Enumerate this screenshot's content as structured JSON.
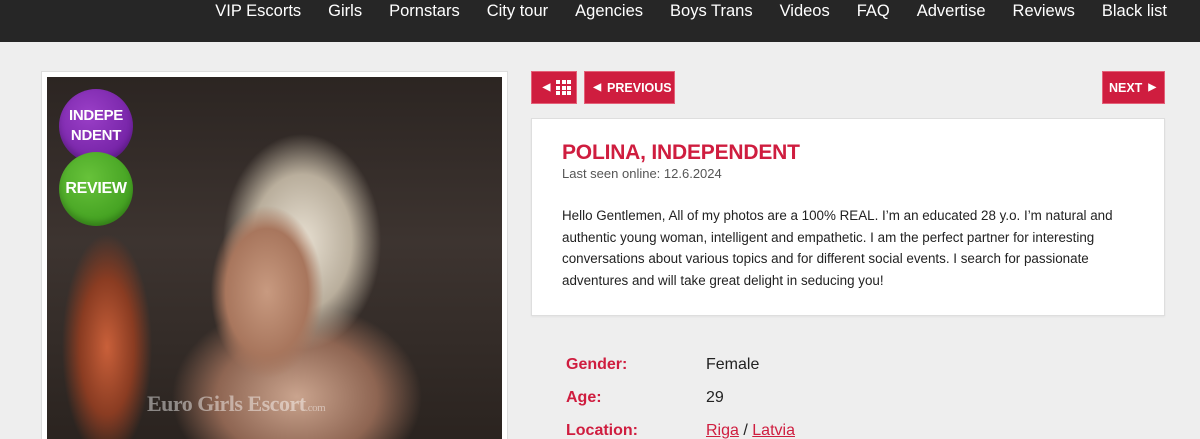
{
  "nav": {
    "items": [
      {
        "label": "VIP Escorts"
      },
      {
        "label": "Girls"
      },
      {
        "label": "Pornstars"
      },
      {
        "label": "City tour"
      },
      {
        "label": "Agencies"
      },
      {
        "label": "Boys Trans"
      },
      {
        "label": "Videos"
      },
      {
        "label": "FAQ"
      },
      {
        "label": "Advertise"
      },
      {
        "label": "Reviews"
      },
      {
        "label": "Black list"
      }
    ]
  },
  "photo": {
    "watermark": "Euro Girls Escort",
    "watermark_suffix": ".com",
    "badges": {
      "independent": "INDEPE NDENT",
      "review": "REVIEW"
    }
  },
  "buttons": {
    "previous": "PREVIOUS",
    "next": "NEXT"
  },
  "profile": {
    "title": "POLINA, INDEPENDENT",
    "last_seen": "Last seen online: 12.6.2024",
    "description": "Hello Gentlemen, All of my photos are a 100% REAL. I’m an educated 28 y.o. I’m natural and authentic young woman, intelligent and empathetic. I am the perfect partner for interesting conversations about various topics and for different social events. I search for passionate adventures and will take great delight in seducing you!"
  },
  "details": {
    "gender_label": "Gender:",
    "gender": "Female",
    "age_label": "Age:",
    "age": "29",
    "location_label": "Location:",
    "city": "Riga",
    "separator": "/",
    "country": "Latvia"
  },
  "colors": {
    "accent": "#cf1d3f",
    "nav_bg": "#262626",
    "page_bg": "#eeeeee"
  }
}
